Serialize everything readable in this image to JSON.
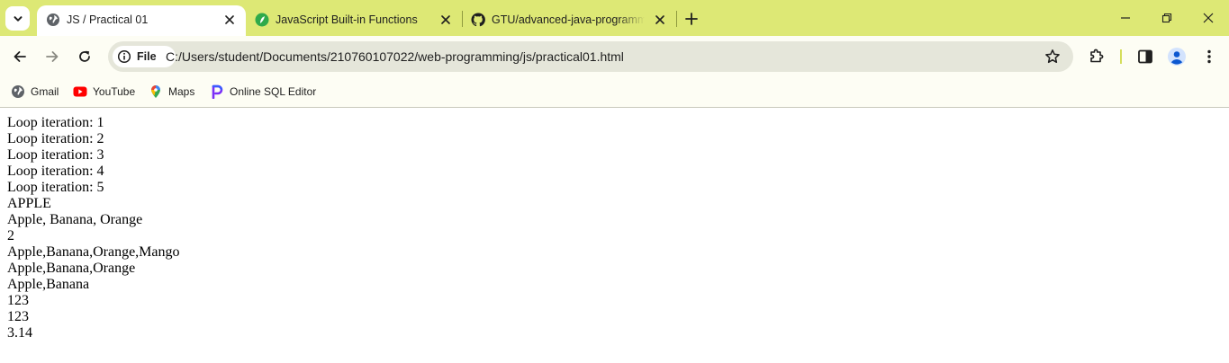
{
  "tabs": [
    {
      "title": "JS / Practical 01",
      "icon": "globe-icon",
      "active": true
    },
    {
      "title": "JavaScript Built-in Functions",
      "icon": "green-leaf-icon",
      "active": false
    },
    {
      "title": "GTU/advanced-java-programming",
      "icon": "github-icon",
      "active": false
    }
  ],
  "address_bar": {
    "chip_label": "File",
    "url": "C:/Users/student/Documents/210760107022/web-programming/js/practical01.html"
  },
  "bookmarks": [
    {
      "label": "Gmail",
      "icon": "globe-icon"
    },
    {
      "label": "YouTube",
      "icon": "youtube-icon"
    },
    {
      "label": "Maps",
      "icon": "maps-pin-icon"
    },
    {
      "label": "Online SQL Editor",
      "icon": "sql-editor-icon"
    }
  ],
  "output_lines": [
    "Loop iteration: 1",
    "Loop iteration: 2",
    "Loop iteration: 3",
    "Loop iteration: 4",
    "Loop iteration: 5",
    "APPLE",
    "Apple, Banana, Orange",
    "2",
    "Apple,Banana,Orange,Mango",
    "Apple,Banana,Orange",
    "Apple,Banana",
    "123",
    "123",
    "3.14"
  ],
  "colors": {
    "tab_strip": "#dde875",
    "toolbar": "#fdfdf4",
    "omnibox": "#e5e6da"
  }
}
